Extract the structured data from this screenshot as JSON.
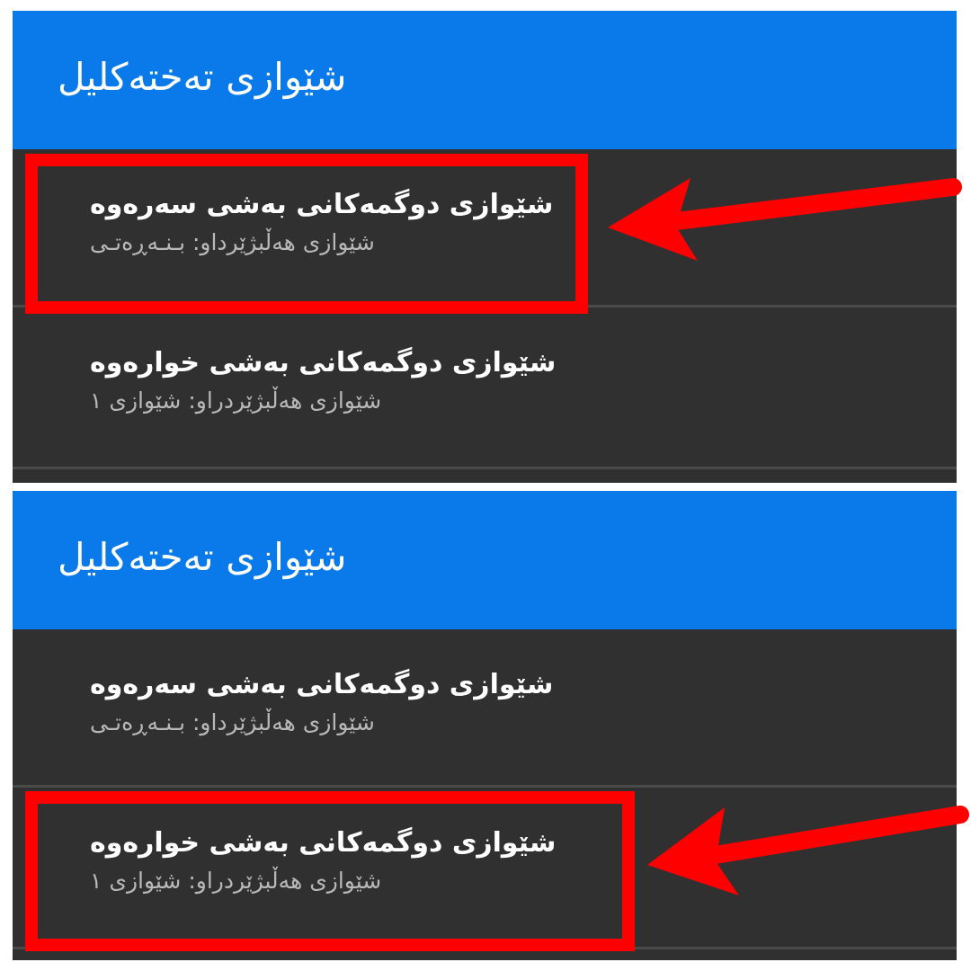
{
  "screens": [
    {
      "appbar": {
        "title": "شێوازی تەختەکلیل"
      },
      "items": [
        {
          "title": "شێوازی دوگمەکانی بەشی سەرەوە",
          "summary": "شێوازی هەڵبژێرداو: بـنـەڕەتـی"
        },
        {
          "title": "شێوازی دوگمەکانی بەشی خوارەوە",
          "summary": "شێوازی هەڵبژێردراو: شێوازی ١"
        }
      ],
      "highlighted_item": 1
    },
    {
      "appbar": {
        "title": "شێوازی تەختەکلیل"
      },
      "items": [
        {
          "title": "شێوازی دوگمەکانی بەشی سەرەوە",
          "summary": "شێوازی هەڵبژێرداو: بـنـەڕەتـی"
        },
        {
          "title": "شێوازی دوگمەکانی بەشی خوارەوە",
          "summary": "شێوازی هەڵبژێردراو: شێوازی ١"
        }
      ],
      "highlighted_item": 2
    }
  ],
  "colors": {
    "appbar": "#0a7aea",
    "background": "#303030",
    "divider": "#4a4a4a",
    "annotation": "#ff0000",
    "title_text": "#ffffff",
    "summary_text": "#b8b8b8"
  },
  "annotation": {
    "type": "red-box-with-arrow"
  }
}
